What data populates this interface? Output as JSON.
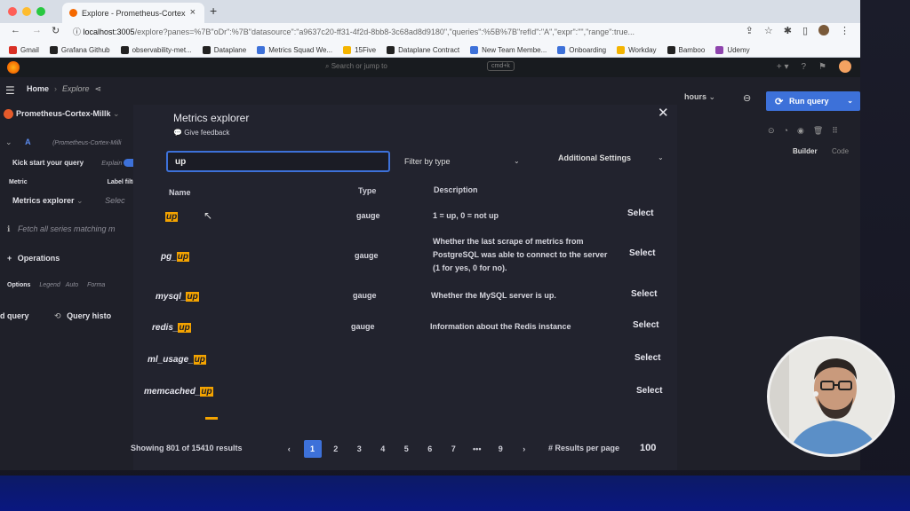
{
  "browser": {
    "tab_title": "Explore - Prometheus-Cortex",
    "url_host": "localhost:3005",
    "url_path": "/explore?panes=%7B\"oDr\":%7B\"datasource\":\"a9637c20-ff31-4f2d-8bb8-3c68ad8d9180\",\"queries\":%5B%7B\"refId\":\"A\",\"expr\":\"\",\"range\":true...",
    "bookmarks": [
      {
        "label": "Gmail",
        "color": "#d93025"
      },
      {
        "label": "Grafana Github",
        "color": "#222"
      },
      {
        "label": "observability-met...",
        "color": "#222"
      },
      {
        "label": "Dataplane",
        "color": "#222"
      },
      {
        "label": "Metrics Squad We...",
        "color": "#3d71d9"
      },
      {
        "label": "15Five",
        "color": "#f4b400"
      },
      {
        "label": "Dataplane Contract",
        "color": "#222"
      },
      {
        "label": "New Team Membe...",
        "color": "#3d71d9"
      },
      {
        "label": "Onboarding",
        "color": "#3d71d9"
      },
      {
        "label": "Workday",
        "color": "#f4b400"
      },
      {
        "label": "Bamboo",
        "color": "#222"
      },
      {
        "label": "Udemy",
        "color": "#8e44ad"
      }
    ]
  },
  "grafana": {
    "search_placeholder": "Search or jump to",
    "cmd_hint": "cmd+k",
    "breadcrumb_home": "Home",
    "breadcrumb_current": "Explore",
    "time_range": "hours",
    "run_query": "Run query",
    "builder": "Builder",
    "code": "Code"
  },
  "left_panel": {
    "datasource": "Prometheus-Cortex-Millk",
    "query_letter": "A",
    "query_ds": "(Prometheus-Cortex-Milli",
    "kickstart": "Kick start your query",
    "explain": "Explain",
    "metric_label": "Metric",
    "label_filters": "Label filte",
    "metrics_explorer": "Metrics explorer",
    "select": "Selec",
    "fetch_all": "Fetch all series matching m",
    "operations": "Operations",
    "options": "Options",
    "legend": "Legend",
    "auto": "Auto",
    "format": "Forma",
    "add_query": "d query",
    "query_history": "Query histo"
  },
  "modal": {
    "title": "Metrics explorer",
    "feedback": "Give feedback",
    "search_value": "up",
    "filter_by_type": "Filter by type",
    "additional_settings": "Additional Settings",
    "columns": {
      "name": "Name",
      "type": "Type",
      "description": "Description"
    },
    "rows": [
      {
        "prefix": "",
        "match": "up",
        "type": "gauge",
        "description": "1 = up, 0 = not up",
        "select": "Select"
      },
      {
        "prefix": "pg_",
        "match": "up",
        "type": "gauge",
        "description": "Whether the last scrape of metrics from PostgreSQL was able to connect to the server (1 for yes, 0 for no).",
        "select": "Select"
      },
      {
        "prefix": "mysql_",
        "match": "up",
        "type": "gauge",
        "description": "Whether the MySQL server is up.",
        "select": "Select"
      },
      {
        "prefix": "redis_",
        "match": "up",
        "type": "gauge",
        "description": "Information about the Redis instance",
        "select": "Select"
      },
      {
        "prefix": "ml_usage_",
        "match": "up",
        "type": "",
        "description": "",
        "select": "Select"
      },
      {
        "prefix": "memcached_",
        "match": "up",
        "type": "",
        "description": "",
        "select": "Select"
      }
    ],
    "showing": "Showing 801 of 15410 results",
    "pages": [
      "‹",
      "1",
      "2",
      "3",
      "4",
      "5",
      "6",
      "7",
      "•••",
      "9",
      "›"
    ],
    "results_per_page_label": "# Results per page",
    "results_per_page": "100"
  }
}
